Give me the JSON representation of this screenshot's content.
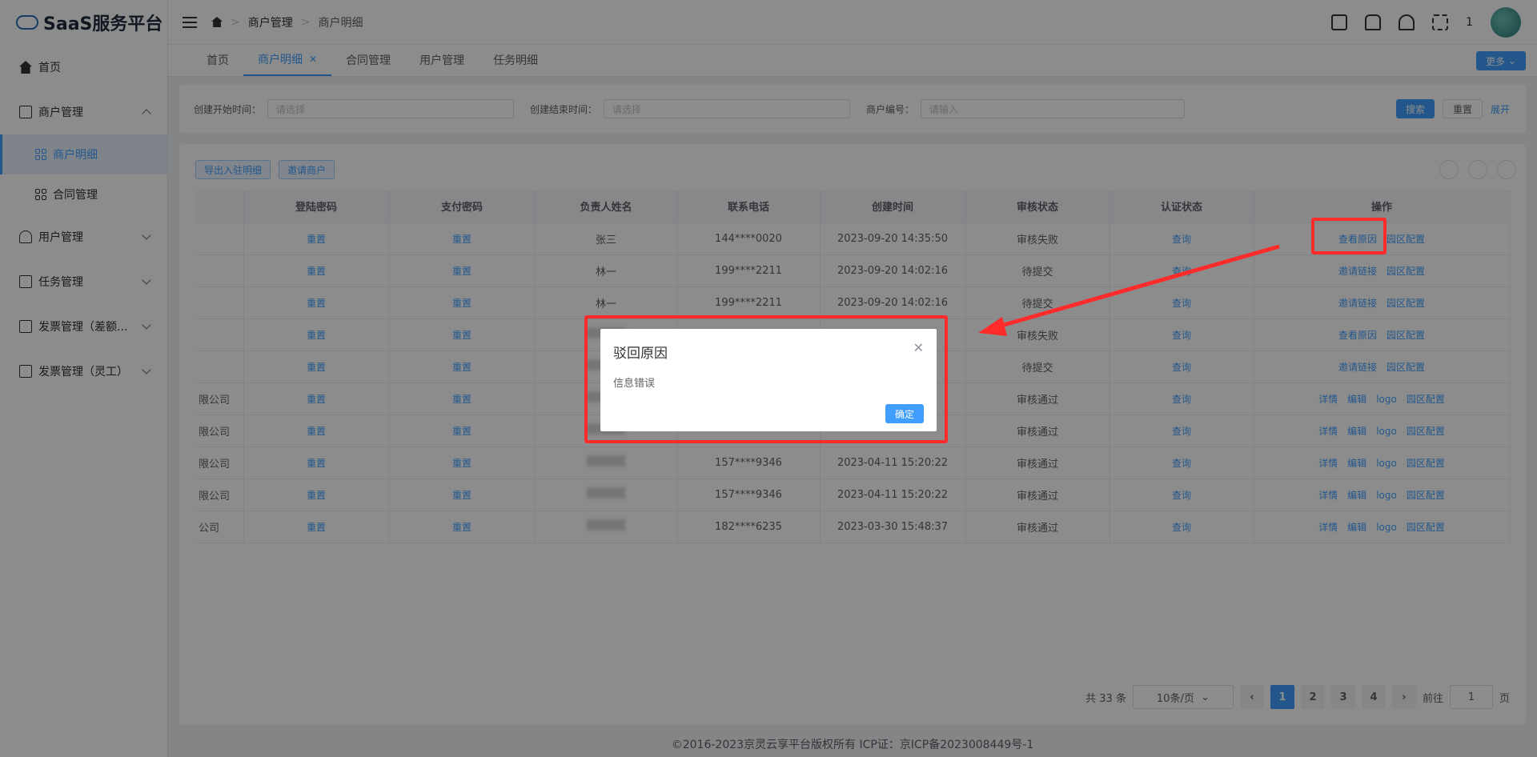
{
  "app": {
    "title": "SaaS服务平台"
  },
  "sidebar": {
    "items": [
      {
        "label": "首页"
      },
      {
        "label": "商户管理"
      },
      {
        "label": "商户明细"
      },
      {
        "label": "合同管理"
      },
      {
        "label": "用户管理"
      },
      {
        "label": "任务管理"
      },
      {
        "label": "发票管理（差额..."
      },
      {
        "label": "发票管理（灵工）"
      }
    ]
  },
  "header": {
    "breadcrumb": [
      "商户管理",
      "商户明细"
    ],
    "notification_count": "1"
  },
  "tabs": [
    {
      "label": "首页"
    },
    {
      "label": "商户明细"
    },
    {
      "label": "合同管理"
    },
    {
      "label": "用户管理"
    },
    {
      "label": "任务明细"
    }
  ],
  "more_label": "更多",
  "search": {
    "start_label": "创建开始时间：",
    "start_placeholder": "请选择",
    "end_label": "创建结束时间：",
    "end_placeholder": "请选择",
    "merchant_label": "商户编号：",
    "merchant_placeholder": "请输入",
    "search_btn": "搜索",
    "reset_btn": "重置",
    "expand_btn": "展开"
  },
  "toolbar": {
    "export_label": "导出入驻明细",
    "invite_label": "邀请商户"
  },
  "table": {
    "headers": [
      "登陆密码",
      "支付密码",
      "负责人姓名",
      "联系电话",
      "创建时间",
      "审核状态",
      "认证状态",
      "操作"
    ],
    "rows": [
      {
        "c0": "",
        "login": "重置",
        "pay": "重置",
        "name": "张三",
        "phone": "144****0020",
        "time": "2023-09-20 14:35:50",
        "audit": "审核失败",
        "auth": "查询",
        "ops": [
          "查看原因",
          "园区配置"
        ]
      },
      {
        "c0": "",
        "login": "重置",
        "pay": "重置",
        "name": "林一",
        "phone": "199****2211",
        "time": "2023-09-20 14:02:16",
        "audit": "待提交",
        "auth": "查询",
        "ops": [
          "邀请链接",
          "园区配置"
        ]
      },
      {
        "c0": "",
        "login": "重置",
        "pay": "重置",
        "name": "林一",
        "phone": "199****2211",
        "time": "2023-09-20 14:02:16",
        "audit": "待提交",
        "auth": "查询",
        "ops": [
          "邀请链接",
          "园区配置"
        ]
      },
      {
        "c0": "",
        "login": "重置",
        "pay": "重置",
        "name": "",
        "phone": "",
        "time": "",
        "audit": "审核失败",
        "auth": "查询",
        "ops": [
          "查看原因",
          "园区配置"
        ]
      },
      {
        "c0": "",
        "login": "重置",
        "pay": "重置",
        "name": "",
        "phone": "",
        "time": "",
        "audit": "待提交",
        "auth": "查询",
        "ops": [
          "邀请链接",
          "园区配置"
        ]
      },
      {
        "c0": "限公司",
        "login": "重置",
        "pay": "重置",
        "name": "",
        "phone": "",
        "time": "",
        "audit": "审核通过",
        "auth": "查询",
        "ops": [
          "详情",
          "编辑",
          "logo",
          "园区配置"
        ]
      },
      {
        "c0": "限公司",
        "login": "重置",
        "pay": "重置",
        "name": "",
        "phone": "",
        "time": "",
        "audit": "审核通过",
        "auth": "查询",
        "ops": [
          "详情",
          "编辑",
          "logo",
          "园区配置"
        ]
      },
      {
        "c0": "限公司",
        "login": "重置",
        "pay": "重置",
        "name": "",
        "phone": "157****9346",
        "time": "2023-04-11 15:20:22",
        "audit": "审核通过",
        "auth": "查询",
        "ops": [
          "详情",
          "编辑",
          "logo",
          "园区配置"
        ]
      },
      {
        "c0": "限公司",
        "login": "重置",
        "pay": "重置",
        "name": "",
        "phone": "157****9346",
        "time": "2023-04-11 15:20:22",
        "audit": "审核通过",
        "auth": "查询",
        "ops": [
          "详情",
          "编辑",
          "logo",
          "园区配置"
        ]
      },
      {
        "c0": "公司",
        "login": "重置",
        "pay": "重置",
        "name": "",
        "phone": "182****6235",
        "time": "2023-03-30 15:48:37",
        "audit": "审核通过",
        "auth": "查询",
        "ops": [
          "详情",
          "编辑",
          "logo",
          "园区配置"
        ]
      }
    ]
  },
  "pagination": {
    "total": "共 33 条",
    "page_size": "10条/页",
    "pages": [
      "1",
      "2",
      "3",
      "4"
    ],
    "goto_label": "前往",
    "goto_value": "1",
    "page_suffix": "页"
  },
  "footer": "©2016-2023京灵云享平台版权所有 ICP证：京ICP备2023008449号-1",
  "dialog": {
    "title": "驳回原因",
    "body": "信息错误",
    "ok": "确定"
  },
  "colors": {
    "primary": "#409eff",
    "annotation": "#ff2a2a"
  }
}
